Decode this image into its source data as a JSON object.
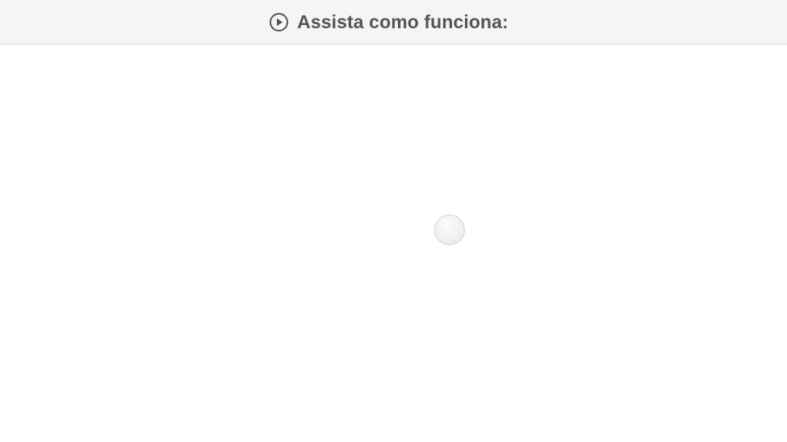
{
  "header": {
    "icon": "play-circle-icon",
    "title": "Assista como funciona:"
  },
  "video": {
    "loader_icon": "loading-spinner-icon"
  },
  "colors": {
    "header_bg": "#f5f5f5",
    "header_text": "#555555",
    "page_bg": "#ffffff"
  }
}
